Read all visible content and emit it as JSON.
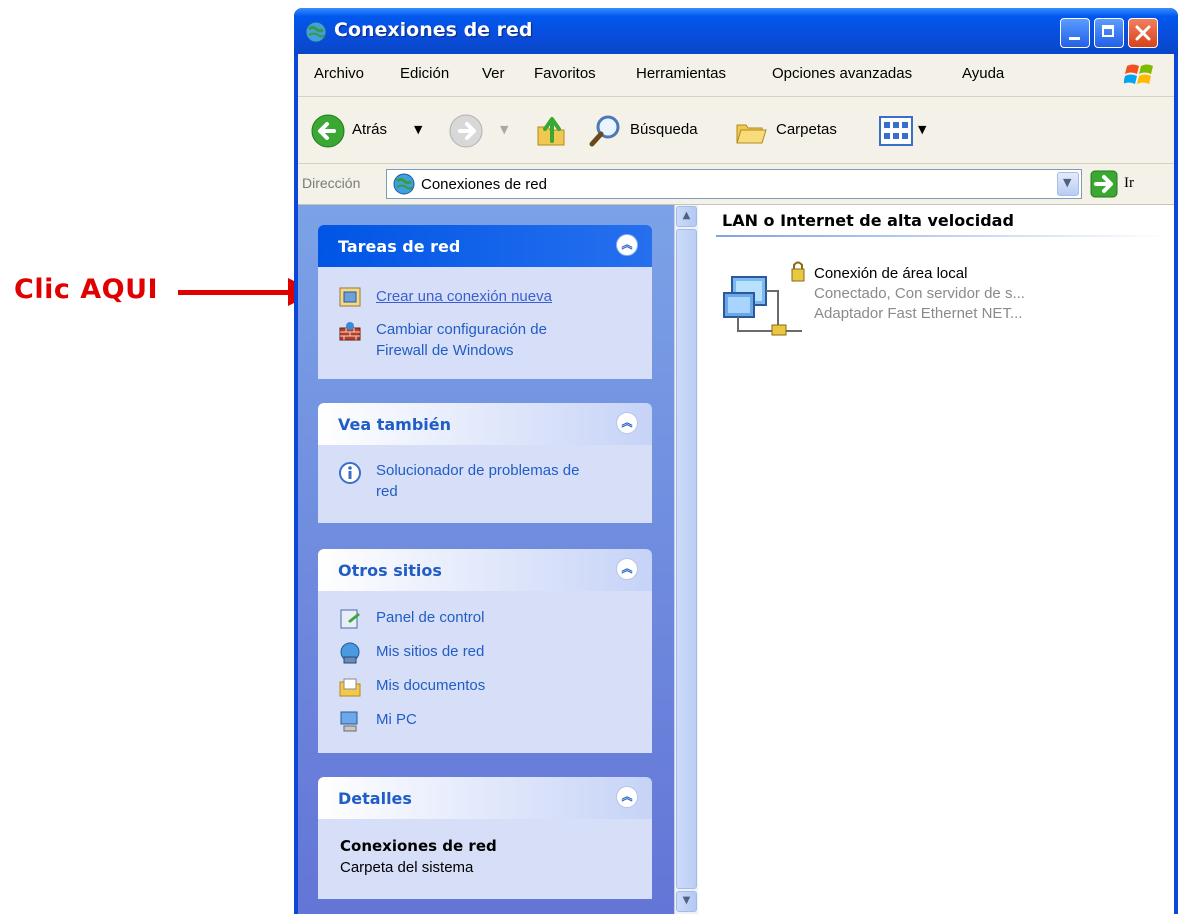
{
  "annotation": {
    "label": "Clic AQUI",
    "color": "#e00000"
  },
  "window": {
    "title": "Conexiones de red"
  },
  "menu": {
    "items": [
      "Archivo",
      "Edición",
      "Ver",
      "Favoritos",
      "Herramientas",
      "Opciones avanzadas",
      "Ayuda"
    ]
  },
  "toolbar": {
    "back_label": "Atrás",
    "search_label": "Búsqueda",
    "folders_label": "Carpetas"
  },
  "address": {
    "label": "Dirección",
    "value": "Conexiones de red",
    "go_label": "Ir"
  },
  "panels": {
    "network_tasks": {
      "title": "Tareas de red",
      "items": [
        {
          "label": "Crear una conexión nueva"
        },
        {
          "label_line1": "Cambiar configuración de",
          "label_line2": "Firewall de Windows"
        }
      ]
    },
    "see_also": {
      "title": "Vea también",
      "items": [
        {
          "label_line1": "Solucionador de problemas de",
          "label_line2": "red"
        }
      ]
    },
    "other_places": {
      "title": "Otros sitios",
      "items": [
        "Panel de control",
        "Mis sitios de red",
        "Mis documentos",
        "Mi PC"
      ]
    },
    "details": {
      "title": "Detalles",
      "name": "Conexiones de red",
      "type": "Carpeta del sistema"
    }
  },
  "content": {
    "group_title": "LAN o Internet de alta velocidad",
    "connection": {
      "name": "Conexión de área local",
      "status": "Conectado, Con servidor de s...",
      "device": "Adaptador Fast Ethernet NET..."
    }
  },
  "colors": {
    "accent": "#215dc6",
    "titlebar": "#0a4ddc",
    "link": "#3b5fd0"
  }
}
